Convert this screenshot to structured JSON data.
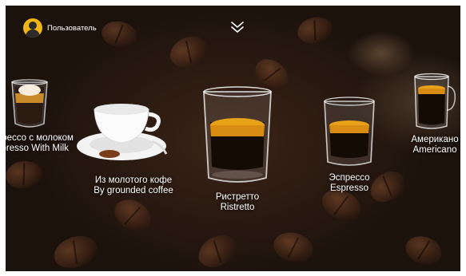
{
  "header": {
    "user_name": "Пользователь",
    "avatar_icon": "user-avatar-icon",
    "collapse_icon": "double-chevron-down-icon"
  },
  "drinks": [
    {
      "name_ru": "Эспрессо с молоком",
      "name_en": "Espresso With Milk",
      "icon": "espresso-with-milk-cup-icon"
    },
    {
      "name_ru": "Из молотого кофе",
      "name_en": "By grounded coffee",
      "icon": "coffee-cup-with-saucer-icon"
    },
    {
      "name_ru": "Ристретто",
      "name_en": "Ristretto",
      "icon": "ristretto-glass-icon"
    },
    {
      "name_ru": "Эспрессо",
      "name_en": "Espresso",
      "icon": "espresso-glass-icon"
    },
    {
      "name_ru": "Американо",
      "name_en": "Americano",
      "icon": "americano-glass-icon"
    }
  ],
  "colors": {
    "crema": "#e8a21a",
    "coffee": "#1a0f08",
    "accent_avatar": "#f0b414",
    "text": "#ffffff"
  }
}
